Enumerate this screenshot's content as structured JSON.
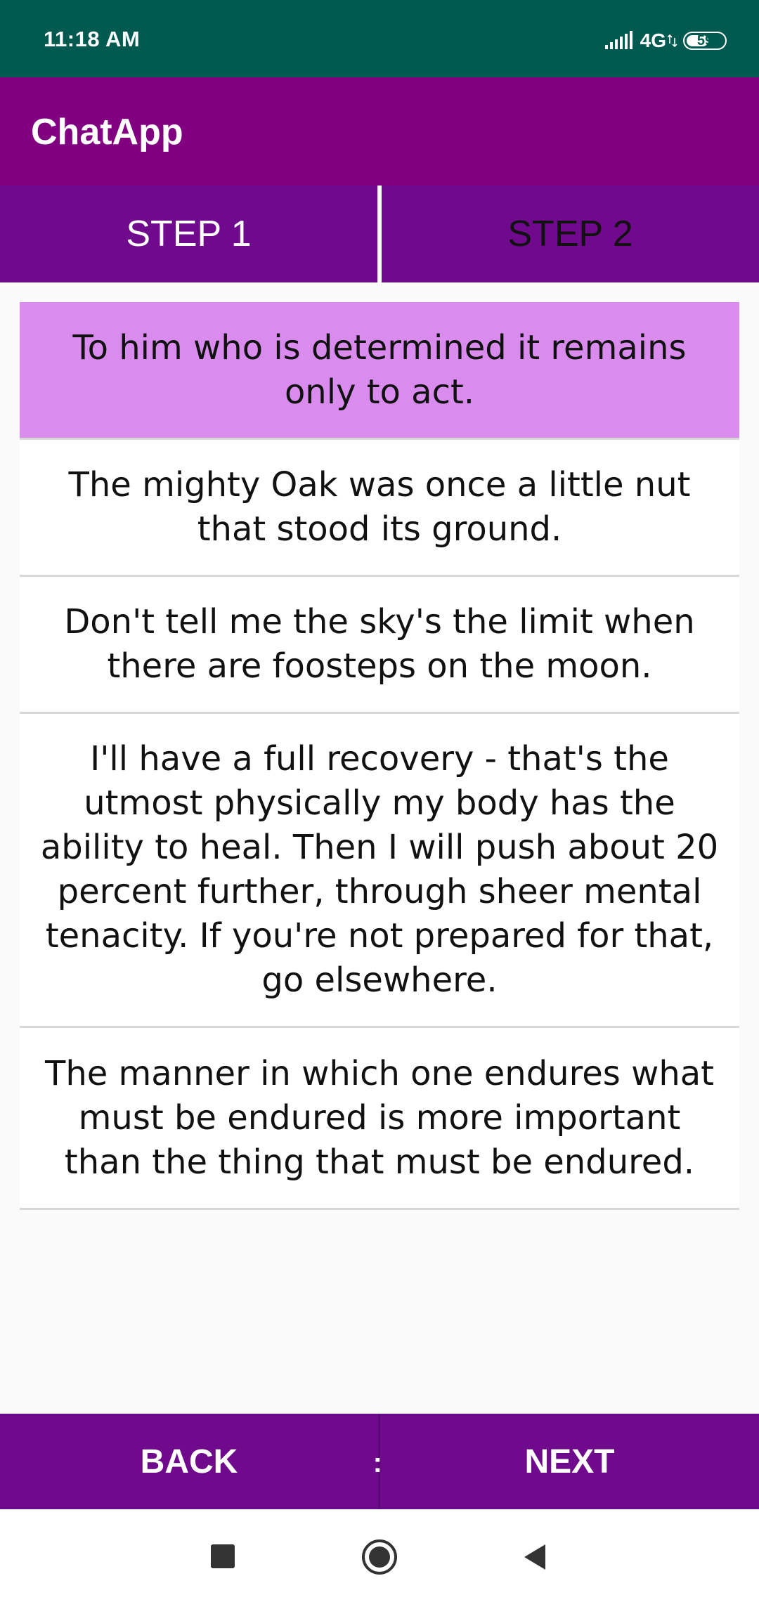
{
  "status_bar": {
    "time": "11:18 AM",
    "network": "4G",
    "battery": "59",
    "battery_level": 0.59,
    "icons": [
      "signal-icon",
      "data-arrows-icon",
      "battery-icon"
    ]
  },
  "app_bar": {
    "title": "ChatApp"
  },
  "tabs": [
    {
      "label": "STEP 1",
      "active": true
    },
    {
      "label": "STEP 2",
      "active": false
    }
  ],
  "quotes": [
    {
      "text": "To him who is determined it remains only to act.",
      "selected": true
    },
    {
      "text": "The mighty Oak was once a little nut that stood its ground.",
      "selected": false
    },
    {
      "text": "Don't tell me the sky's the limit when there are foosteps on the moon.",
      "selected": false
    },
    {
      "text": "I'll have a full recovery - that's the utmost physically my body has the ability to heal. Then I will push about 20 percent further, through sheer mental tenacity. If you're not prepared for that, go elsewhere.",
      "selected": false
    },
    {
      "text": "The manner in which one endures what must be endured is more important than the thing that must be endured.",
      "selected": false
    }
  ],
  "bottom_bar": {
    "back_label": "BACK",
    "next_label": "NEXT",
    "handle_glyph": ":"
  },
  "nav_bar": {
    "icons": [
      "recents-square-icon",
      "home-circle-icon",
      "back-triangle-icon"
    ]
  },
  "colors": {
    "status_bar": "#005a4f",
    "app_bar": "#800080",
    "tab_bar": "#6f0a8c",
    "selected_item": "#d98cee",
    "bottom_bar": "#6f0a8c"
  }
}
